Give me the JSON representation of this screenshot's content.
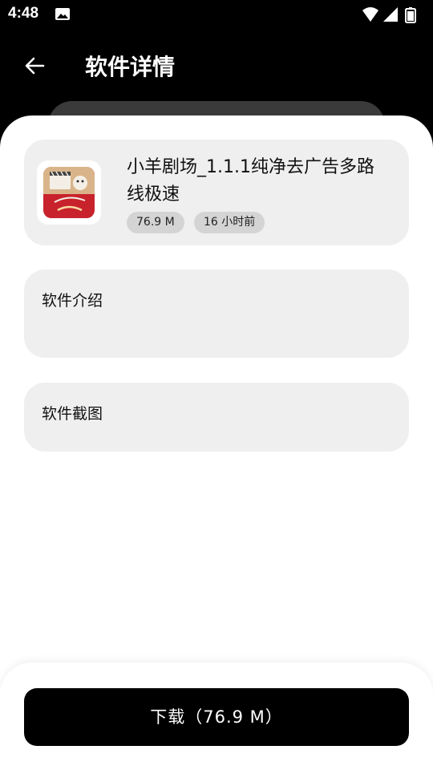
{
  "status_bar": {
    "time": "4:48",
    "icons": [
      "image-icon",
      "wifi-icon",
      "signal-icon",
      "battery-icon"
    ]
  },
  "app_bar": {
    "title": "软件详情",
    "back_icon": "arrow-left-icon"
  },
  "app_info": {
    "name": "小羊剧场_1.1.1纯净去广告多路线极速",
    "size": "76.9 M",
    "updated": "16 小时前",
    "icon": "app-logo"
  },
  "sections": {
    "intro_title": "软件介绍",
    "screenshots_title": "软件截图"
  },
  "download": {
    "label": "下载（76.9 M）"
  },
  "colors": {
    "header_bg": "#000000",
    "card_bg": "#efefef",
    "chip_bg": "#d4d4d4",
    "button_bg": "#000000",
    "icon_red": "#c8232c"
  }
}
